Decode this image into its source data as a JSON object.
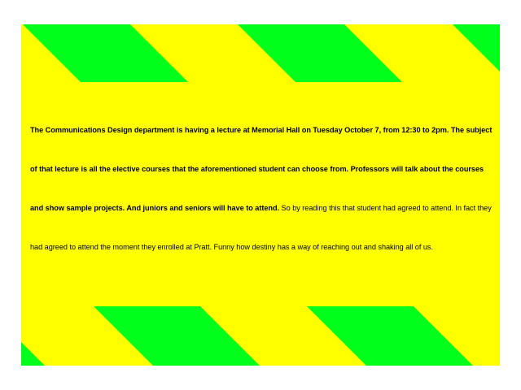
{
  "colors": {
    "background": "#ffffff",
    "panel": "#ffff00",
    "stripe": "#00ff1a",
    "text": "#000000"
  },
  "message": {
    "bold_text": "The Communications Design department is having a lecture at Memorial Hall on Tuesday October 7, from 12:30 to 2pm. The subject of that lecture is all the elective courses that the aforementioned student can choose from. Professors will talk about the courses and show sample projects. And juniors and seniors will have to attend.",
    "regular_text": " So by reading this that student had agreed to attend. In fact they had agreed to attend the moment they enrolled at Pratt. Funny how destiny has a way of reaching out and shaking all of us."
  }
}
